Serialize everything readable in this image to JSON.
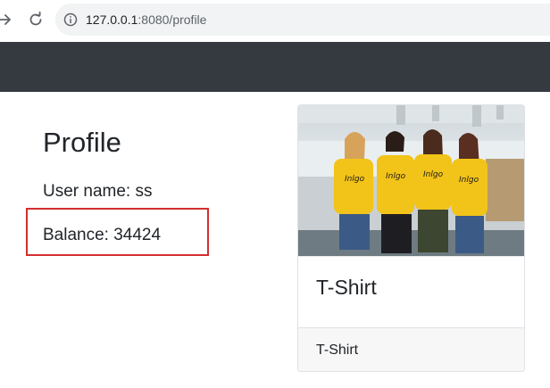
{
  "browser": {
    "url_host": "127.0.0.1",
    "url_rest": ":8080/profile",
    "icons": {
      "forward": "arrow-forward-icon",
      "reload": "reload-icon",
      "info": "info-icon"
    }
  },
  "profile": {
    "title": "Profile",
    "username_line": "User name: ss",
    "balance_line": "Balance: 34424",
    "highlight_color": "#d32f2f"
  },
  "card": {
    "image": "photo of four people in yellow t-shirts",
    "title": "T-Shirt",
    "footer": "T-Shirt"
  },
  "colors": {
    "navbar": "#343a40",
    "shirt": "#f2c318"
  }
}
